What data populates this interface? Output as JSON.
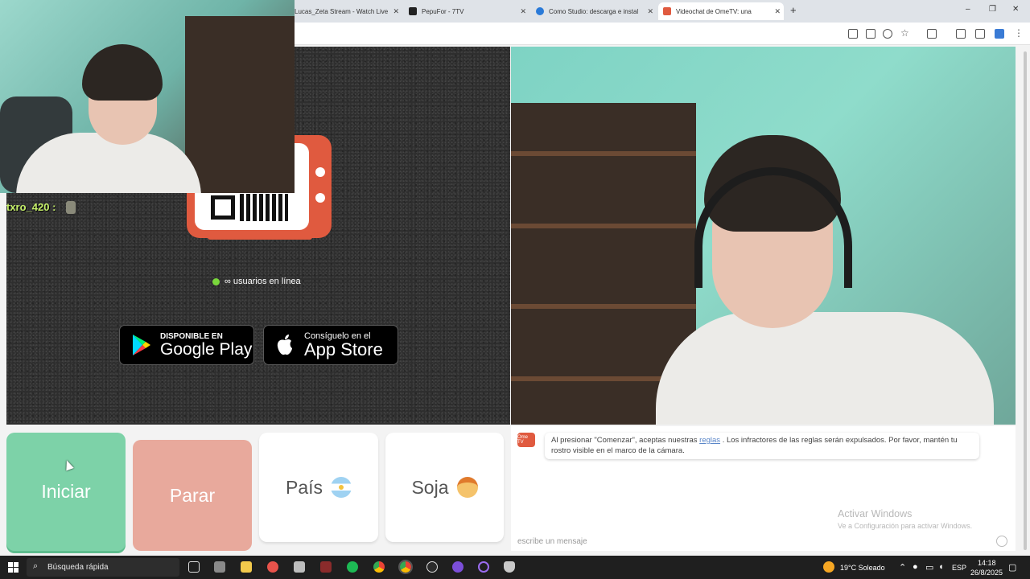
{
  "browser": {
    "tabs": [
      {
        "label": "Lucas_Zeta Stream - Watch Live",
        "active": false
      },
      {
        "label": "PepuFor - 7TV",
        "active": false
      },
      {
        "label": "Como Studio: descarga e instal",
        "active": false
      },
      {
        "label": "Videochat de OmeTV: una",
        "active": true
      }
    ],
    "new_tab": "+",
    "window_controls": [
      "–",
      "❐",
      "✕"
    ]
  },
  "stream_overlay": {
    "chat_username": "txro_420 :"
  },
  "ometv": {
    "online_text": "∞ usuarios en línea",
    "google_play": {
      "small": "DISPONIBLE EN",
      "big": "Google Play"
    },
    "app_store": {
      "small": "Consíguelo en el",
      "big": "App Store"
    },
    "buttons": {
      "start": "Iniciar",
      "stop": "Parar",
      "country": "País",
      "gender": "Soja"
    },
    "chat": {
      "logo_text": "Ome TV",
      "notice_before": "Al presionar \"Comenzar\", aceptas nuestras",
      "notice_link": "reglas",
      "notice_after": ". Los infractores de las reglas serán expulsados. Por favor, mantén tu rostro visible en el marco de la cámara.",
      "input_placeholder": "escribe un mensaje",
      "activate_title": "Activar Windows",
      "activate_sub": "Ve a Configuración para activar Windows."
    }
  },
  "taskbar": {
    "search_placeholder": "Búsqueda rápida",
    "weather": "19°C  Soleado",
    "language": "ESP",
    "time": "14:18",
    "date": "26/8/2025"
  },
  "colors": {
    "start_green": "#7dd2a8",
    "stop_salmon": "#e8a99c",
    "brand_red": "#e05a3f",
    "online_dot": "#7ad83c"
  }
}
